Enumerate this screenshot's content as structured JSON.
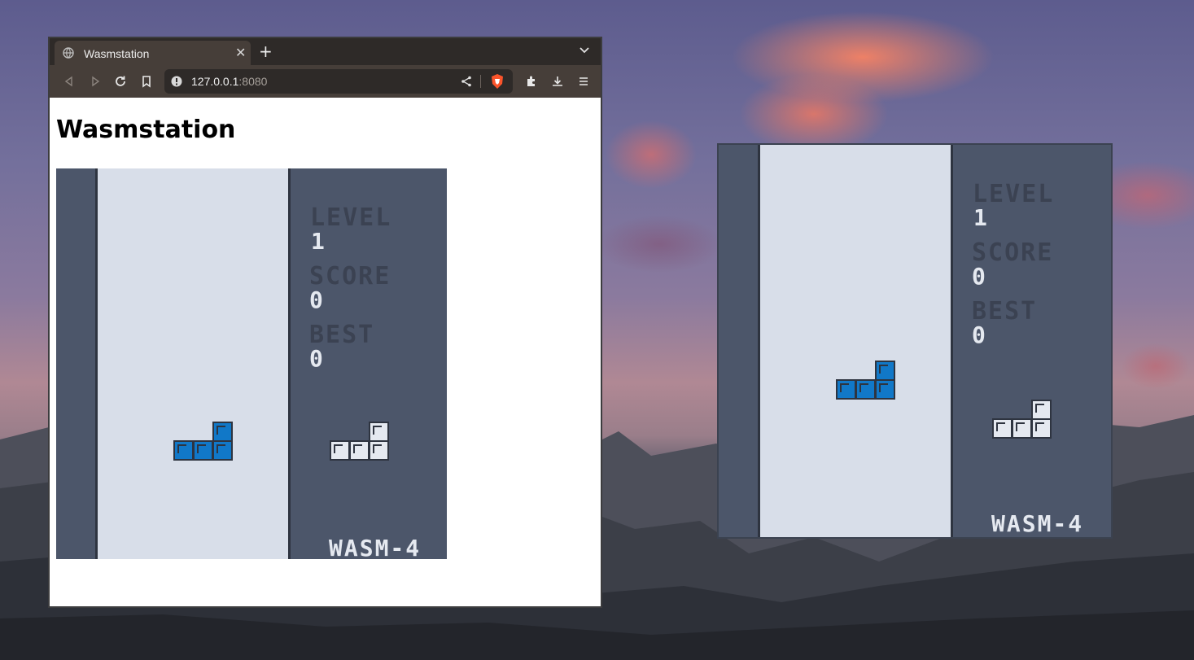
{
  "browser": {
    "tab_title": "Wasmstation",
    "tab_close": "✕",
    "new_tab": "+",
    "url_host": "127.0.0.1",
    "url_port": ":8080"
  },
  "page": {
    "heading": "Wasmstation"
  },
  "game": {
    "level_label": "LEVEL",
    "level_value": "1",
    "score_label": "SCORE",
    "score_value": "0",
    "best_label": "BEST",
    "best_value": "0",
    "logo": "WASM-4"
  },
  "colors": {
    "well": "#d8dee9",
    "panel": "#4c566a",
    "piece_current": "#1178c8",
    "piece_next": "#e5e9f0"
  },
  "icons": [
    "globe-icon",
    "close-icon",
    "plus-icon",
    "chevron-down-icon",
    "back-icon",
    "forward-icon",
    "reload-icon",
    "bookmark-icon",
    "info-icon",
    "share-icon",
    "brave-shields-icon",
    "extensions-icon",
    "download-icon",
    "menu-icon"
  ]
}
